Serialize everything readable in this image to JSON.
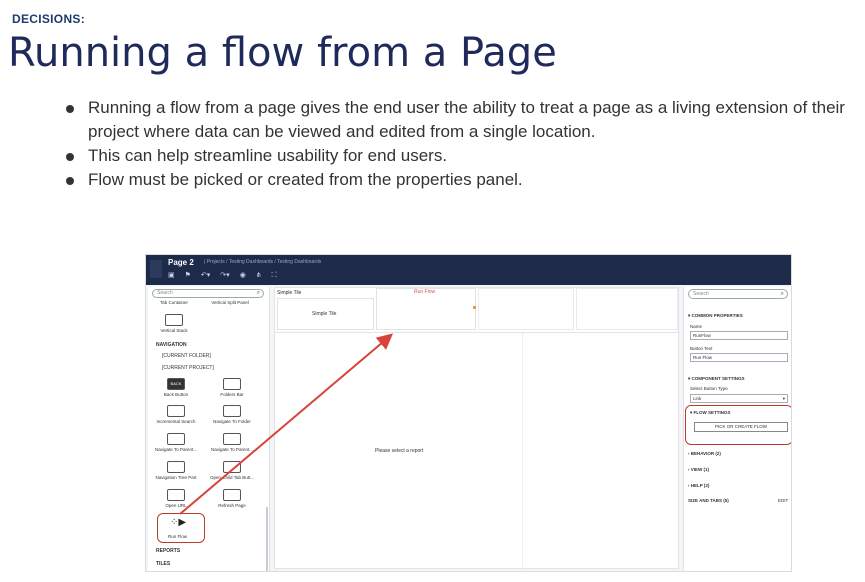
{
  "slide": {
    "kicker": "DECISIONS:",
    "title": "Running a flow from a Page",
    "bullets": [
      "Running a flow from a page gives the end user the ability to treat a page as a living extension of their project where data can be viewed and edited from a single location.",
      "This can help streamline usability for end users.",
      "Flow must be picked or created from the properties panel."
    ]
  },
  "app": {
    "page_name": "Page 2",
    "breadcrumb": "| Projects / Testing Dashboards / Testing Dashboards",
    "toolbar_icons": [
      "save-icon",
      "flag-icon",
      "undo-icon",
      "redo-icon",
      "eye-icon",
      "share-icon",
      "expand-icon"
    ],
    "toolbar_glyphs": [
      "▣",
      "⚑",
      "↶▾",
      "↷▾",
      "◉",
      "⋔",
      "⛶"
    ]
  },
  "left_panel": {
    "search_placeholder": "Search",
    "top_items": [
      "Tab Container",
      "Vertical Split Panel",
      "Vertical Stack"
    ],
    "section_navigation": "NAVIGATION",
    "sub_items": [
      "[CURRENT FOLDER]",
      "[CURRENT PROJECT]"
    ],
    "components": [
      "Back Button",
      "Folders Bar",
      "Incremental Search",
      "Navigate To Folder",
      "Navigate To Parent...",
      "Navigate To Parent...",
      "Navigation Tree Part",
      "Open Child Tab Butt...",
      "Open URL",
      "Refresh Page"
    ],
    "back_icon_text": "BACK",
    "run_flow": "Run Flow",
    "section_reports": "REPORTS",
    "section_tiles": "TILES"
  },
  "canvas": {
    "tile_title": "Simple Tile",
    "tile_body": "Simple Tile",
    "run_flow_tile": "Run Flow",
    "report_message": "Please select a report"
  },
  "right_panel": {
    "search_placeholder": "Search",
    "common_properties": "COMMON PROPERTIES",
    "name_label": "Name",
    "name_value": "RunFlow",
    "button_text_label": "Button Text",
    "button_text_value": "Run Flow",
    "component_settings": "COMPONENT SETTINGS",
    "button_type_label": "Select Button Type",
    "button_type_value": "Link",
    "flow_settings": "FLOW SETTINGS",
    "pick_button": "PICK OR CREATE FLOW",
    "behavior": "BEHAVIOR (2)",
    "view": "VIEW (1)",
    "help": "HELP (2)",
    "size_tabs": "SIZE AND TABS (5)",
    "edit": "EDIT"
  },
  "colors": {
    "title": "#1f2a5a",
    "app_bar": "#1e2a4a",
    "highlight": "#c0392b",
    "arrow": "#d9443a"
  }
}
